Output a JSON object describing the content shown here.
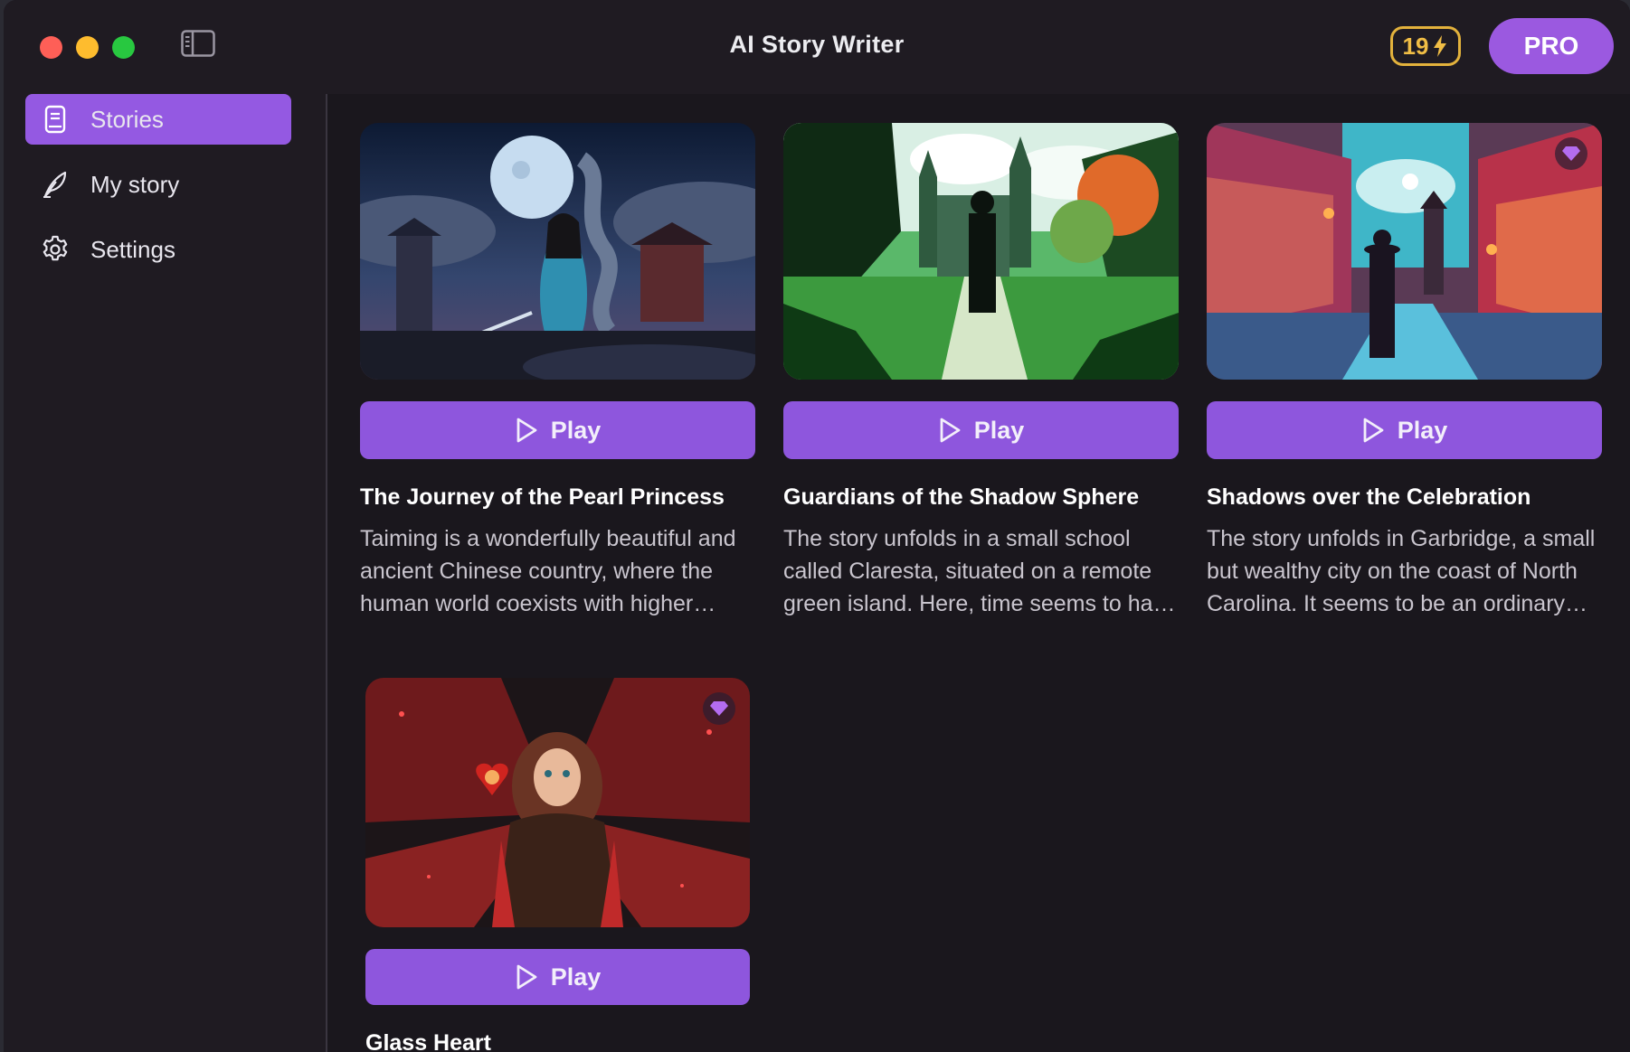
{
  "window": {
    "title": "AI Story Writer",
    "credits": "19",
    "pro_label": "PRO"
  },
  "colors": {
    "accent": "#9459e2",
    "pro": "#9b59e0",
    "credits": "#e3b23c",
    "background": "#1a171d"
  },
  "sidebar": {
    "items": [
      {
        "label": "Stories",
        "icon": "book-icon",
        "active": true
      },
      {
        "label": "My story",
        "icon": "feather-icon",
        "active": false
      },
      {
        "label": "Settings",
        "icon": "gear-icon",
        "active": false
      }
    ]
  },
  "stories": [
    {
      "title": "The Journey of the Pearl Princess",
      "description": "Taiming is a wonderfully beautiful and ancient Chinese country, where the human world coexists with higher realms of gods and dragons.",
      "play_label": "Play",
      "premium": false
    },
    {
      "title": "Guardians of the Shadow Sphere",
      "description": "The story unfolds in a small school called Claresta, situated on a remote green island. Here, time seems to have stopped long ago.",
      "play_label": "Play",
      "premium": false
    },
    {
      "title": "Shadows over the Celebration",
      "description": "The story unfolds in Garbridge, a small but wealthy city on the coast of North Carolina. It seems to be an ordinary town.",
      "play_label": "Play",
      "premium": true
    },
    {
      "title": "Glass Heart",
      "description": "",
      "play_label": "Play",
      "premium": true
    }
  ]
}
